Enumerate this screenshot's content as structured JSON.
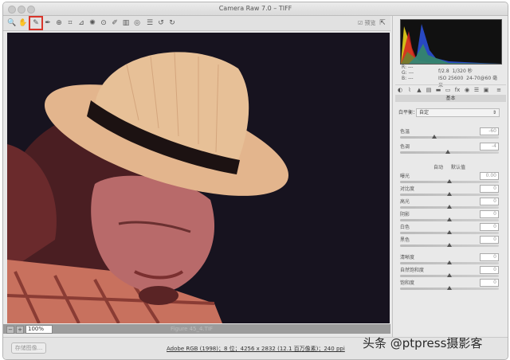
{
  "window": {
    "title": "Camera Raw 7.0 – TIFF"
  },
  "toolbar": {
    "tools": [
      "zoom-icon",
      "hand-icon",
      "white-balance-icon",
      "color-sampler-icon",
      "targeted-adjustment-icon",
      "crop-icon",
      "straighten-icon",
      "spot-removal-icon",
      "red-eye-icon",
      "adjustment-brush-icon",
      "graduated-filter-icon",
      "radial-filter-icon",
      "open-preferences-icon",
      "rotate-ccw-icon",
      "rotate-cw-icon"
    ],
    "selected_index": 2,
    "preview_label": "预览"
  },
  "status": {
    "zoom": "100%",
    "filename": "Figure 45_4.TIF"
  },
  "bottom": {
    "save_label": "存储图像...",
    "workflow_link": "Adobe RGB (1998)；8 位；4256 x 2832 (12.1 百万像素)；240 ppi"
  },
  "info": {
    "r": "R:",
    "g": "G:",
    "b": "B:",
    "dash": "---",
    "aperture": "f/2.8",
    "shutter": "1/320 秒",
    "iso": "ISO 25600",
    "lens": "24-70@60 毫米"
  },
  "panel": {
    "title": "基本",
    "wb_label": "白平衡：",
    "wb_value": "自定",
    "auto_label": "自动",
    "default_label": "默认值",
    "sliders": [
      {
        "label": "色温",
        "value": "-60",
        "pos": 0.35
      },
      {
        "label": "色调",
        "value": "-4",
        "pos": 0.48
      },
      {
        "label": "曝光",
        "value": "0.00",
        "pos": 0.5
      },
      {
        "label": "对比度",
        "value": "0",
        "pos": 0.5
      },
      {
        "label": "高光",
        "value": "0",
        "pos": 0.5
      },
      {
        "label": "阴影",
        "value": "0",
        "pos": 0.5
      },
      {
        "label": "白色",
        "value": "0",
        "pos": 0.5
      },
      {
        "label": "黑色",
        "value": "0",
        "pos": 0.5
      },
      {
        "label": "清晰度",
        "value": "0",
        "pos": 0.5
      },
      {
        "label": "自然饱和度",
        "value": "0",
        "pos": 0.5
      },
      {
        "label": "饱和度",
        "value": "0",
        "pos": 0.5
      }
    ]
  },
  "watermark": "头条 @ptpress摄影客"
}
